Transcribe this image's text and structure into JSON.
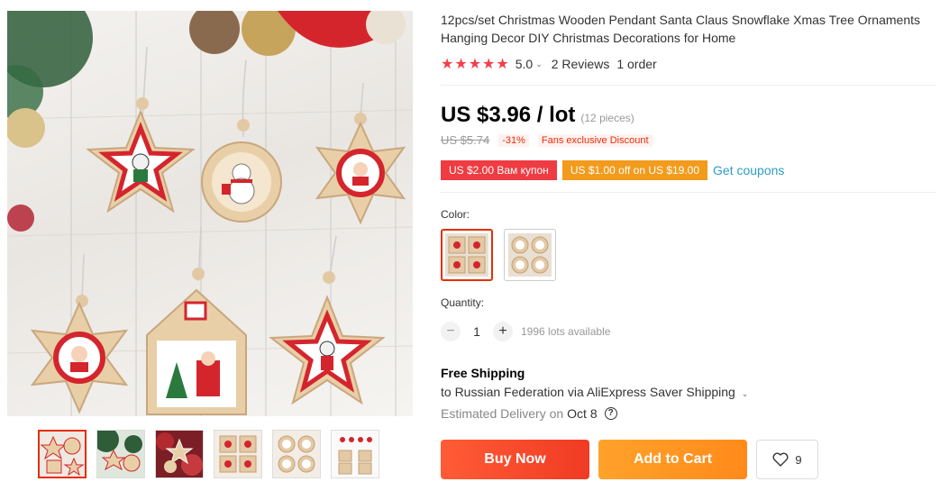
{
  "product": {
    "title_line1": "12pcs/set Christmas Wooden Pendant Santa Claus Snowflake Xmas Tree Ornaments",
    "title_line2": "Hanging Decor DIY Christmas Decorations for Home",
    "stars": "★★★★★",
    "rating": "5.0",
    "reviews": "2 Reviews",
    "orders": "1 order"
  },
  "price": {
    "current": "US $3.96 / lot",
    "pieces": "(12 pieces)",
    "original": "US $5.74",
    "discount": "-31%",
    "fans_discount": "Fans exclusive Discount"
  },
  "coupons": {
    "coupon1": "US $2.00 Вам купон",
    "coupon2": "US $1.00 off on US $19.00",
    "get_coupons": "Get coupons"
  },
  "options": {
    "color_label": "Color:",
    "quantity_label": "Quantity:",
    "minus": "−",
    "plus": "+",
    "quantity": "1",
    "available": "1996 lots available"
  },
  "shipping": {
    "title": "Free Shipping",
    "to": "to Russian Federation via AliExpress Saver Shipping",
    "delivery_prefix": "Estimated Delivery on",
    "delivery_date": "Oct 8"
  },
  "actions": {
    "buy_now": "Buy Now",
    "add_to_cart": "Add to Cart",
    "wishlist_count": "9"
  },
  "colors": {
    "accent_red": "#e62e04",
    "star_red": "#f43f4b",
    "link_blue": "#2e9cc3",
    "coupon_orange": "#f29b1c"
  }
}
